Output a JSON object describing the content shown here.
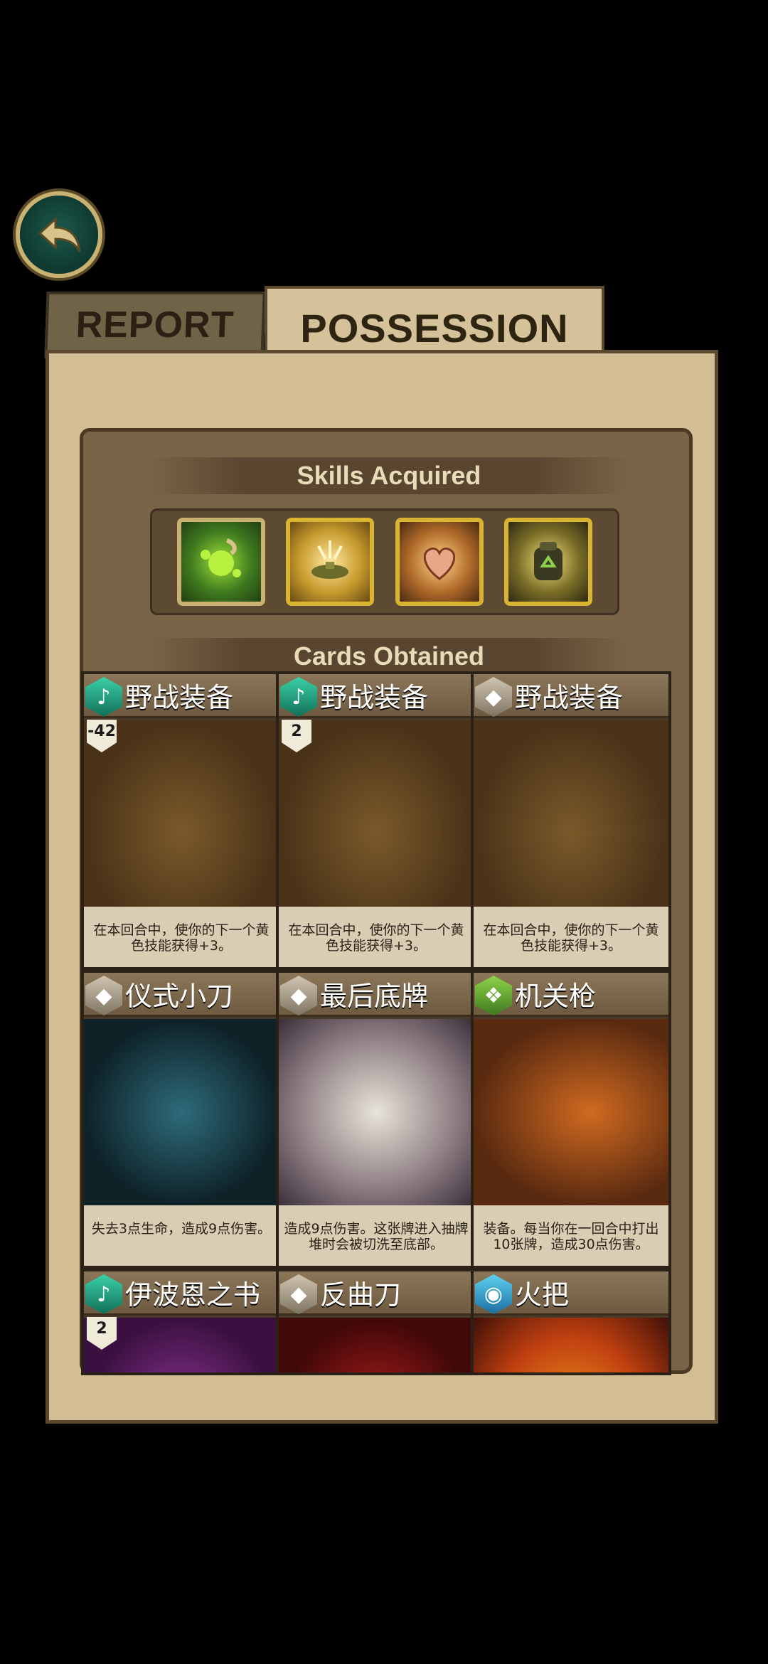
{
  "tabs": {
    "report": "REPORT",
    "possession": "POSSESSION"
  },
  "sections": {
    "skills": "Skills Acquired",
    "cards": "Cards Obtained"
  },
  "skills": [
    {
      "icon": "acid-splash-icon"
    },
    {
      "icon": "landmine-icon"
    },
    {
      "icon": "heart-hand-icon"
    },
    {
      "icon": "recycle-backpack-icon"
    }
  ],
  "cards": [
    {
      "title": "野战装备",
      "cost": "-42",
      "gem": "teal",
      "desc": "在本回合中，使你的下一个黄色技能获得+3。",
      "art": "bag"
    },
    {
      "title": "野战装备",
      "cost": "2",
      "gem": "teal",
      "desc": "在本回合中，使你的下一个黄色技能获得+3。",
      "art": "bag"
    },
    {
      "title": "野战装备",
      "cost": "",
      "gem": "grey",
      "desc": "在本回合中，使你的下一个黄色技能获得+3。",
      "art": "bag"
    },
    {
      "title": "仪式小刀",
      "cost": "",
      "gem": "grey",
      "desc": "失去3点生命，造成9点伤害。",
      "art": "knife"
    },
    {
      "title": "最后底牌",
      "cost": "",
      "gem": "grey",
      "desc": "造成9点伤害。这张牌进入抽牌堆时会被切洗至底部。",
      "art": "card"
    },
    {
      "title": "机关枪",
      "cost": "",
      "gem": "green",
      "desc": "装备。每当你在一回合中打出10张牌，造成30点伤害。",
      "art": "gun"
    },
    {
      "title": "伊波恩之书",
      "cost": "2",
      "gem": "teal",
      "desc": "",
      "art": "book"
    },
    {
      "title": "反曲刀",
      "cost": "",
      "gem": "grey",
      "desc": "",
      "art": "blade"
    },
    {
      "title": "火把",
      "cost": "",
      "gem": "blue",
      "desc": "",
      "art": "fire"
    }
  ]
}
